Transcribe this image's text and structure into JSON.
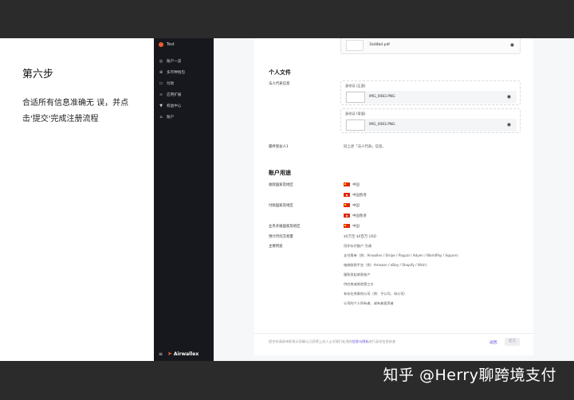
{
  "watermark": "知乎 @Herry聊跨境支付",
  "left_panel": {
    "title": "第六步",
    "desc": "合适所有信息准确无 误，并点击'提交'完成注册流程"
  },
  "sidebar": {
    "account_name": "Test",
    "items": [
      {
        "icon": "home-icon",
        "label": "账户一览"
      },
      {
        "icon": "wallet-icon",
        "label": "多币种钱包"
      },
      {
        "icon": "card-icon",
        "label": "付款"
      },
      {
        "icon": "link-icon",
        "label": "应用扩展"
      },
      {
        "icon": "filter-icon",
        "label": "权益中心"
      },
      {
        "icon": "bank-icon",
        "label": "账户"
      }
    ],
    "menu_glyph": "≡",
    "brand": "Airwallex"
  },
  "top_file": {
    "name": "1b48bd.pdf"
  },
  "sections": {
    "personal_docs": "个人文件",
    "account_usage": "账户用途"
  },
  "personal": {
    "legal_rep_label": "法人代表信息",
    "doc1_title": "身份证 (正面)",
    "doc1_file": "IMG_0083.PNG",
    "doc2_title": "身份证 (背面)",
    "doc2_file": "IMG_0083.PNG",
    "ubo_label": "最终受益人1",
    "ubo_value": "同上述「法人代表」信息。"
  },
  "usage": {
    "collect_label": "收款国家及地区",
    "collect_values": [
      "中国",
      "中国香港"
    ],
    "pay_label": "付款国家及地区",
    "pay_values": [
      "中国",
      "中国香港"
    ],
    "ops_label": "业务开展国家及地区",
    "ops_value": "中国",
    "volume_label": "预计月均交易量",
    "volume_value": "$0万至 $0百万 USD",
    "purpose_label": "主要用途",
    "purposes": [
      "用作存付能户 为诵",
      "支付周单（例：Airwallex / Stripe / Paypal / Adyen / WorldPay / Square）",
      "电商收款平台（例：Amazon / eBay / Shopify / Wish）",
      "服款发起收款账户",
      "供应商或其他第三方",
      "有存在关联的公司（例：子公司、母公司）",
      "公司的个人所有者、或有者投资者"
    ]
  },
  "footer": {
    "text_pre": "提交申请表单即表示您确认已获得上述人士对我们处理其",
    "text_link": "信息与隐私",
    "text_post": "进行身份信息核查",
    "back_label": "返回",
    "submit_label": "提交"
  }
}
